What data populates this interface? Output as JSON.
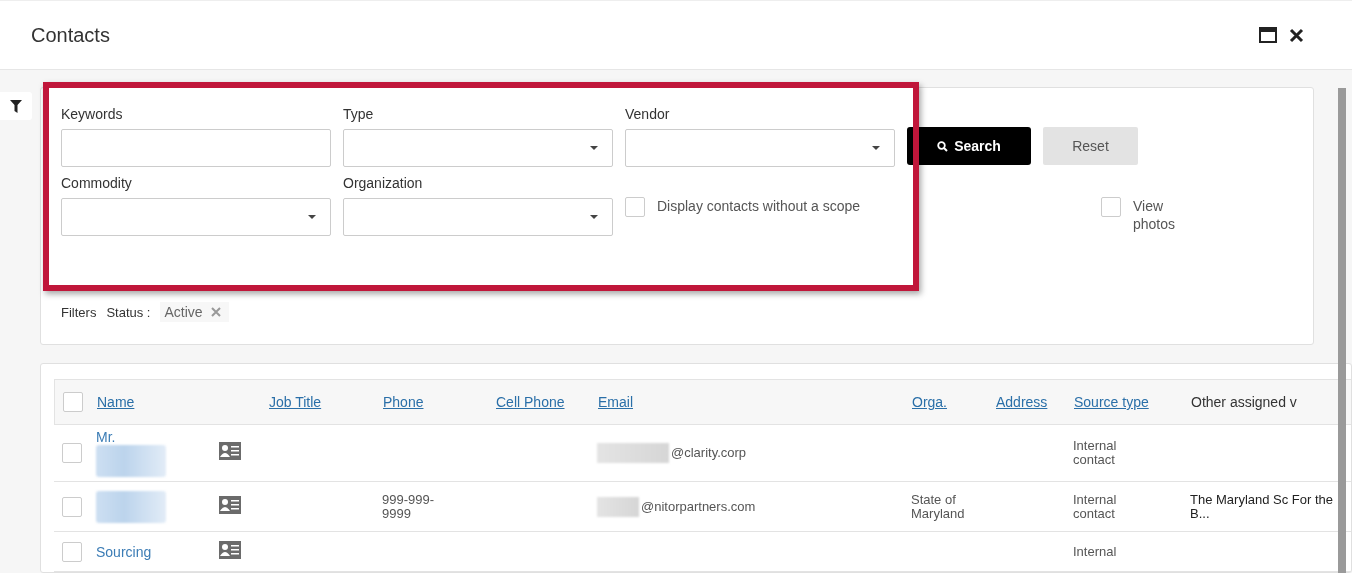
{
  "window": {
    "title": "Contacts"
  },
  "search_panel": {
    "fields": [
      {
        "label": "Keywords",
        "kind": "text"
      },
      {
        "label": "Type",
        "kind": "select"
      },
      {
        "label": "Vendor",
        "kind": "select"
      },
      {
        "label": "Commodity",
        "kind": "select"
      },
      {
        "label": "Organization",
        "kind": "select"
      }
    ],
    "search_button": "Search",
    "reset_button": "Reset",
    "without_scope": {
      "label": "Display contacts without a scope",
      "checked": false
    },
    "view_photos": {
      "label": "View photos",
      "checked": false
    },
    "filters": {
      "label": "Filters",
      "chips": [
        {
          "name": "Status :",
          "value": "Active"
        }
      ]
    }
  },
  "table": {
    "all_checked": false,
    "columns": [
      {
        "label": "Name",
        "link": true
      },
      {
        "label": "Job Title",
        "link": true
      },
      {
        "label": "Phone",
        "link": true
      },
      {
        "label": "Cell Phone",
        "link": true
      },
      {
        "label": "Email",
        "link": true
      },
      {
        "label": "Orga.",
        "link": true
      },
      {
        "label": "Address",
        "link": true
      },
      {
        "label": "Source type",
        "link": true
      },
      {
        "label": "Other assigned v",
        "link": false
      }
    ],
    "rows": [
      {
        "checked": false,
        "name": "Mr.",
        "name_redacted": true,
        "email": "@clarity.corp",
        "email_redacted": true,
        "source_type": "Internal contact"
      },
      {
        "checked": false,
        "name_redacted": true,
        "phone": "999-999-9999",
        "email": "@nitorpartners.com",
        "email_redacted": true,
        "orga": "State of Maryland",
        "source_type": "Internal contact",
        "other": "The Maryland Sc For the B..."
      },
      {
        "checked": false,
        "name": "Sourcing",
        "name_redacted": false,
        "email_redacted": false,
        "source_type": "Internal"
      }
    ]
  }
}
